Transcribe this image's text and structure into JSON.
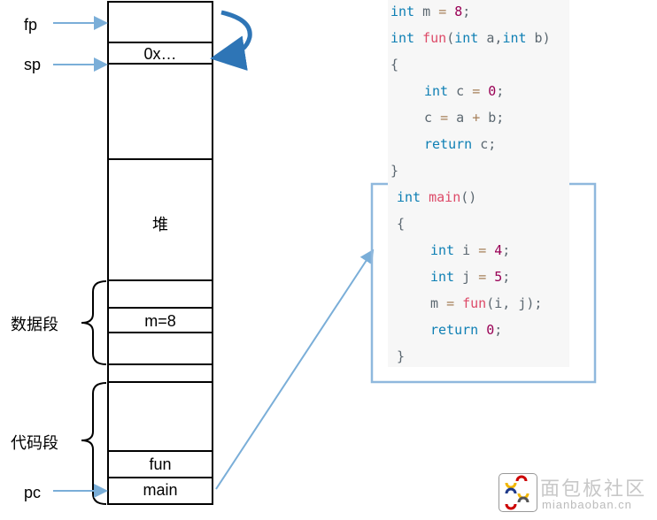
{
  "pointers": {
    "fp": "fp",
    "sp": "sp",
    "pc": "pc"
  },
  "memory": {
    "cells": {
      "sp_value": "0x…",
      "heap": "堆",
      "m": "m=8",
      "fun": "fun",
      "main": "main"
    }
  },
  "segments": {
    "data": "数据段",
    "code": "代码段"
  },
  "code": {
    "l1": {
      "kw": "int",
      "rest": " m ",
      "op": "=",
      "num": " 8",
      ";": ";"
    },
    "lines": [
      [
        "int",
        " m ",
        "=",
        " 8",
        ";"
      ],
      [
        "int",
        " ",
        "fun",
        "(int a,int b)"
      ],
      [
        "{"
      ],
      [
        "int",
        " c ",
        "=",
        " 0",
        ";"
      ],
      [
        "c ",
        "=",
        " a ",
        "+",
        " b;"
      ],
      [
        "return",
        " c;"
      ],
      [
        "}"
      ],
      [
        "int",
        " ",
        "main",
        "()"
      ],
      [
        "{"
      ],
      [
        "int",
        " i ",
        "=",
        " 4",
        ";"
      ],
      [
        "int",
        " j ",
        "=",
        " 5",
        ";"
      ],
      [
        "m ",
        "=",
        " ",
        "fun",
        "(i, j);"
      ],
      [
        "return",
        " 0",
        ";"
      ],
      [
        "}"
      ]
    ]
  },
  "watermark": {
    "cn": "面包板社区",
    "en": "mianbaoban.cn"
  },
  "colors": {
    "arrow": "#7aaed8",
    "box": "#8fb8dd",
    "curve": "#2e75b6"
  }
}
